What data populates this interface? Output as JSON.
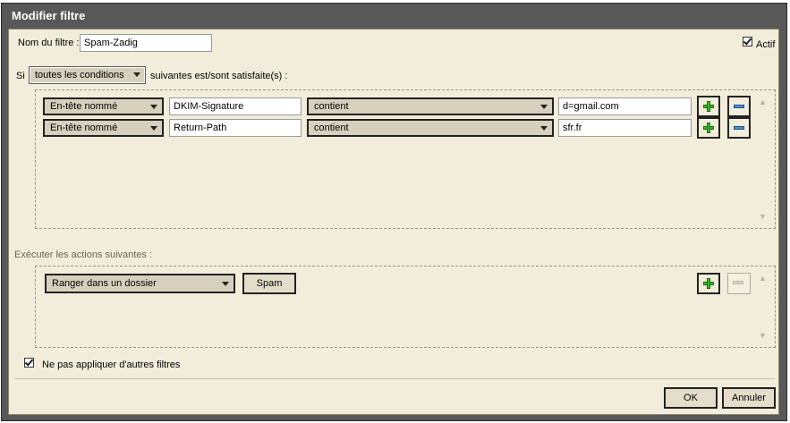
{
  "dialog": {
    "title": "Modifier filtre"
  },
  "filter": {
    "name_label": "Nom du filtre :",
    "name_value": "Spam-Zadig",
    "active_label": "Actif",
    "active_checked": true
  },
  "conditions": {
    "prefix": "Si",
    "mode": "toutes les conditions",
    "suffix": "suivantes est/sont satisfaite(s) :",
    "rows": [
      {
        "field": "En-tête nommé",
        "header": "DKIM-Signature",
        "operator": "contient",
        "value": "d=gmail.com"
      },
      {
        "field": "En-tête nommé",
        "header": "Return-Path",
        "operator": "contient",
        "value": "sfr.fr"
      }
    ]
  },
  "actions": {
    "heading": "Exécuter les actions suivantes :",
    "rows": [
      {
        "action": "Ranger dans un dossier",
        "folder": "Spam"
      }
    ]
  },
  "stop_option": {
    "label": "Ne pas appliquer d'autres filtres",
    "checked": true
  },
  "buttons": {
    "ok": "OK",
    "cancel": "Annuler"
  },
  "icons": {
    "add": "plus-icon",
    "remove": "minus-icon",
    "scroll_up": "chevron-up-icon",
    "scroll_down": "chevron-down-icon"
  },
  "colors": {
    "title_bar": "#585858",
    "panel_bg": "#f2ecdb",
    "add_green": "#3bbd2d",
    "remove_blue": "#4a8fd8"
  }
}
